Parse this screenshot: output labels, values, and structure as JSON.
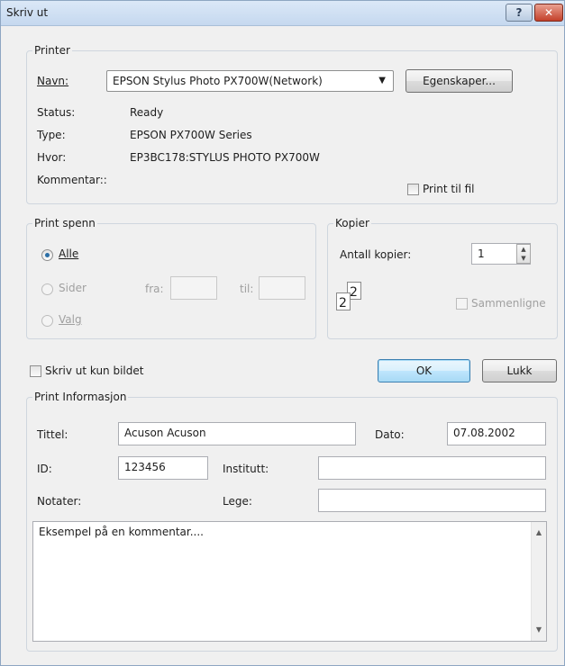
{
  "window": {
    "title": "Skriv ut",
    "help_label": "?",
    "close_label": "✕"
  },
  "printer": {
    "legend": "Printer",
    "name_label": "Navn:",
    "name_value": "EPSON Stylus Photo PX700W(Network)",
    "properties_button": "Egenskaper...",
    "status_label": "Status:",
    "status_value": "Ready",
    "type_label": "Type:",
    "type_value": "EPSON PX700W Series",
    "where_label": "Hvor:",
    "where_value": "EP3BC178:STYLUS PHOTO PX700W",
    "comment_label": "Kommentar::",
    "print_to_file_label": "Print til fil"
  },
  "print_range": {
    "legend": "Print spenn",
    "all_label": "Alle",
    "pages_label": "Sider",
    "from_label": "fra:",
    "to_label": "til:",
    "selection_label": "Valg"
  },
  "copies": {
    "legend": "Kopier",
    "count_label": "Antall kopier:",
    "count_value": "1",
    "collate_label": "Sammenligne",
    "page_icon_digits": [
      "2",
      "2"
    ]
  },
  "print_image_only_label": "Skriv ut kun bildet",
  "buttons": {
    "ok": "OK",
    "close": "Lukk"
  },
  "info": {
    "legend": "Print Informasjon",
    "title_label": "Tittel:",
    "title_value": "Acuson Acuson",
    "date_label": "Dato:",
    "date_value": "07.08.2002",
    "id_label": "ID:",
    "id_value": "123456",
    "institute_label": "Institutt:",
    "institute_value": "",
    "notes_label": "Notater:",
    "doctor_label": "Lege:",
    "doctor_value": "",
    "comment_text": "Eksempel på en kommentar...."
  },
  "icons": {
    "dropdown": "chevron-down-icon",
    "scroll_up": "triangle-up-icon",
    "scroll_down": "triangle-down-icon"
  }
}
